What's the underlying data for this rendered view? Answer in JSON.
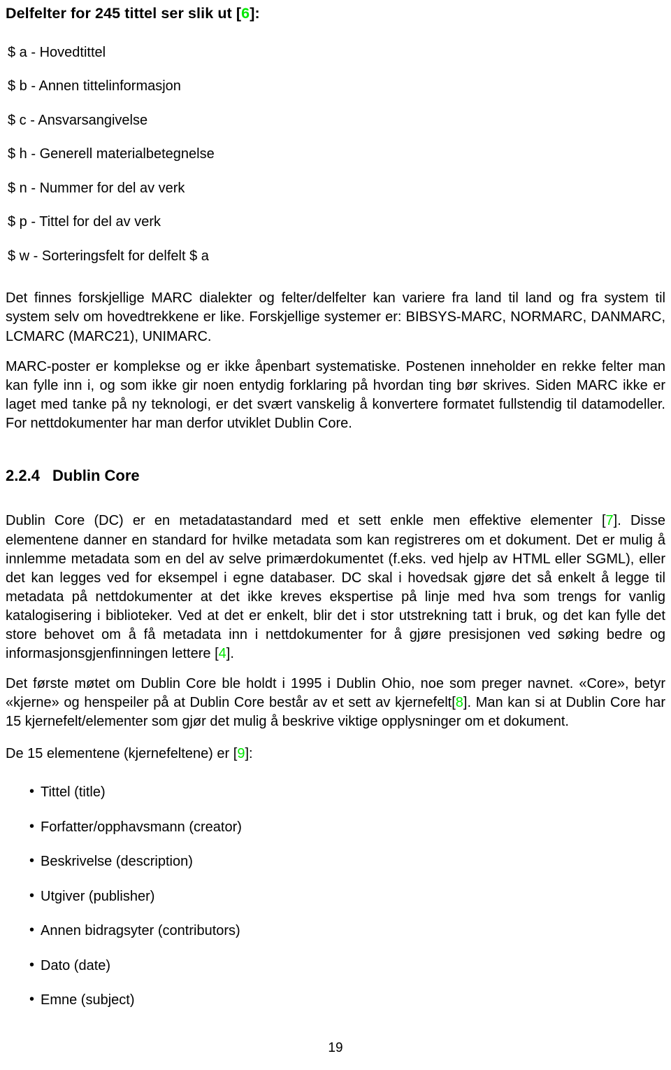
{
  "document": {
    "page_number": "19",
    "ref_color": "#00e800"
  },
  "lead_heading": {
    "text_before": "Delfelter for 245 tittel ser slik ut [",
    "ref": "6",
    "text_after": "]:"
  },
  "subfields": [
    {
      "label": "$ a - Hovedtittel"
    },
    {
      "label": "$ b - Annen tittelinformasjon"
    },
    {
      "label": "$ c - Ansvarsangivelse"
    },
    {
      "label": "$ h - Generell materialbetegnelse"
    },
    {
      "label": "$ n - Nummer for del av verk"
    },
    {
      "label": "$ p - Tittel for del av verk"
    },
    {
      "label": "$ w - Sorteringsfelt for delfelt $ a"
    }
  ],
  "paragraphs": {
    "marc_dialects": "Det finnes forskjellige MARC dialekter og felter/delfelter kan variere fra land til land og fra system til system selv om hovedtrekkene er like. Forskjellige systemer er: BIBSYS-MARC, NORMARC, DANMARC, LCMARC (MARC21), UNIMARC.",
    "marc_records": "MARC-poster er komplekse og er ikke åpenbart systematiske. Postenen inneholder en rekke felter man kan fylle inn i, og som ikke gir noen entydig forklaring på hvordan ting bør skrives. Siden MARC ikke er laget med tanke på ny teknologi, er det svært vanskelig å konvertere formatet fullstendig til datamodeller. For nettdokumenter har man derfor utviklet Dublin Core.",
    "dublin_core_intro_part1": "Dublin Core (DC) er en metadatastandard med et sett enkle men effektive elementer [",
    "dublin_core_intro_ref1": "7",
    "dublin_core_intro_part2": "]. Disse elementene danner en standard for hvilke metadata som kan registreres om et dokument. Det er mulig å innlemme metadata som en del av selve primærdokumentet (f.eks. ved hjelp av HTML eller SGML), eller det kan legges ved for eksempel i egne databaser. DC skal i hovedsak gjøre det så enkelt å legge til metadata på nettdokumenter at det ikke kreves ekspertise på linje med hva som trengs for vanlig katalogisering i biblioteker. Ved at det er enkelt, blir det i stor utstrekning tatt i bruk, og det kan fylle det store behovet om å få metadata inn i nettdokumenter for å gjøre presisjonen ved søking bedre og informasjonsgjenfinningen lettere [",
    "dublin_core_intro_ref2": "4",
    "dublin_core_intro_part3": "].",
    "dublin_core_history_part1": "Det første møtet om Dublin Core ble holdt i 1995 i Dublin Ohio, noe som preger navnet. «Core», betyr «kjerne» og henspeiler på at Dublin Core består av et sett av kjernefelt[",
    "dublin_core_history_ref": "8",
    "dublin_core_history_part2": "]. Man kan si at Dublin Core har 15 kjernefelt/elementer som gjør det mulig å beskrive viktige opplysninger om et dokument."
  },
  "section_heading": {
    "number": "2.2.4",
    "title": "Dublin Core"
  },
  "elements_intro": {
    "text_before": "De 15 elementene (kjernefeltene) er [",
    "ref": "9",
    "text_after": "]:"
  },
  "elements": [
    {
      "bullet": "•",
      "label": "Tittel (title)"
    },
    {
      "bullet": "•",
      "label": "Forfatter/opphavsmann (creator)"
    },
    {
      "bullet": "•",
      "label": "Beskrivelse (description)"
    },
    {
      "bullet": "•",
      "label": "Utgiver (publisher)"
    },
    {
      "bullet": "•",
      "label": "Annen bidragsyter (contributors)"
    },
    {
      "bullet": "•",
      "label": "Dato (date)"
    },
    {
      "bullet": "•",
      "label": "Emne (subject)"
    }
  ]
}
